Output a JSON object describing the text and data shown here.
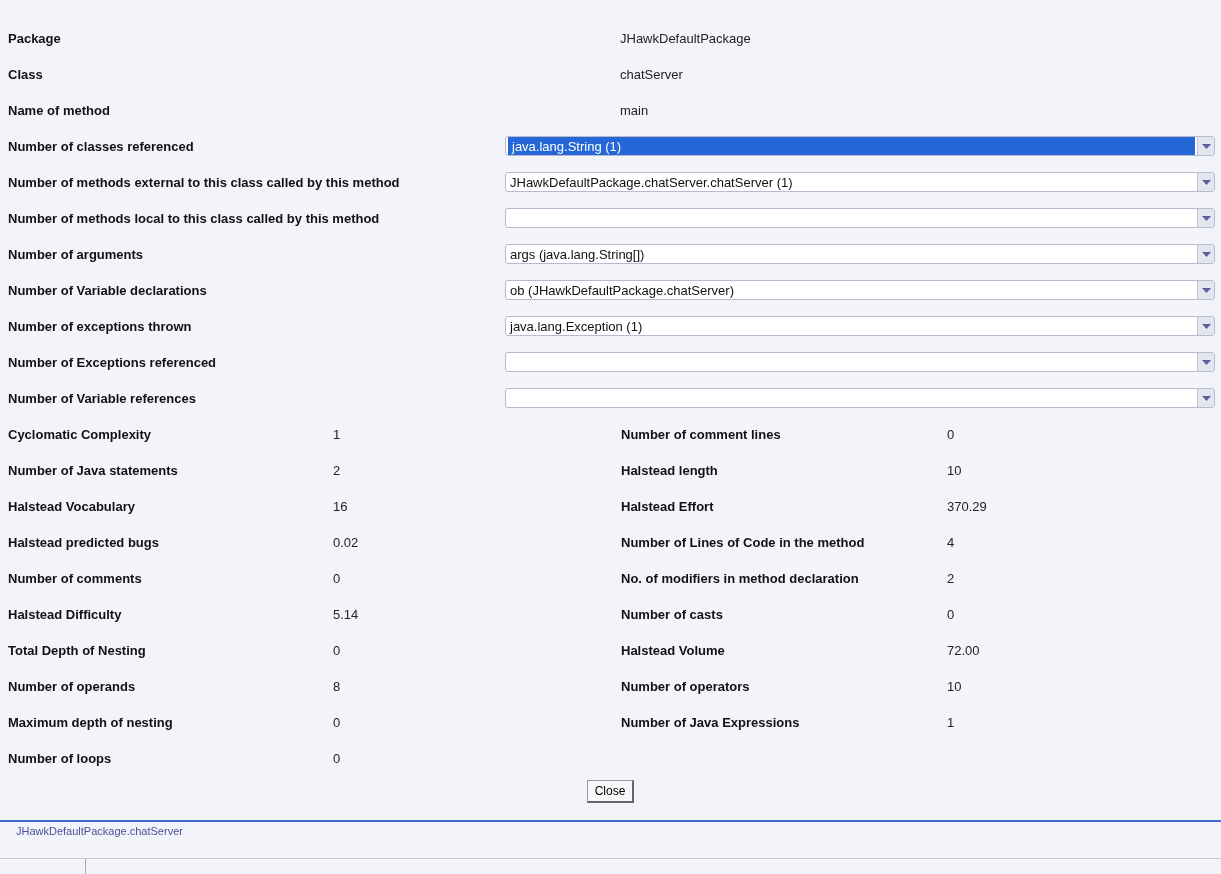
{
  "header": [
    {
      "label": "Package",
      "value": "JHawkDefaultPackage"
    },
    {
      "label": "Class",
      "value": "chatServer"
    },
    {
      "label": "Name of method",
      "value": "main"
    }
  ],
  "lists": [
    {
      "label": "Number of classes referenced",
      "value": "java.lang.String (1)",
      "selected": true
    },
    {
      "label": "Number of methods external to this class called by this method",
      "value": "JHawkDefaultPackage.chatServer.chatServer (1)",
      "selected": false
    },
    {
      "label": "Number of methods local to this class called by this method",
      "selected": false
    },
    {
      "label": "Number of arguments",
      "value": "args (java.lang.String[])",
      "selected": false
    },
    {
      "label": "Number of Variable declarations",
      "value": "ob (JHawkDefaultPackage.chatServer)",
      "selected": false
    },
    {
      "label": "Number of exceptions thrown",
      "value": "java.lang.Exception (1)",
      "selected": false
    },
    {
      "label": "Number of Exceptions referenced",
      "selected": false
    },
    {
      "label": "Number of Variable references",
      "selected": false
    }
  ],
  "metrics_left": [
    {
      "label": "Cyclomatic Complexity",
      "value": "1"
    },
    {
      "label": "Number of Java statements",
      "value": "2"
    },
    {
      "label": "Halstead Vocabulary",
      "value": "16"
    },
    {
      "label": "Halstead predicted bugs",
      "value": "0.02"
    },
    {
      "label": "Number of comments",
      "value": "0"
    },
    {
      "label": "Halstead Difficulty",
      "value": "5.14"
    },
    {
      "label": "Total Depth of Nesting",
      "value": "0"
    },
    {
      "label": "Number of operands",
      "value": "8"
    },
    {
      "label": "Maximum depth of nesting",
      "value": "0"
    },
    {
      "label": "Number of loops",
      "value": "0"
    }
  ],
  "metrics_right": [
    {
      "label": "Number of comment lines",
      "value": "0"
    },
    {
      "label": "Halstead length",
      "value": "10"
    },
    {
      "label": "Halstead Effort",
      "value": "370.29"
    },
    {
      "label": "Number of Lines of Code in the method",
      "value": "4"
    },
    {
      "label": "No. of modifiers in method declaration",
      "value": "2"
    },
    {
      "label": "Number of casts",
      "value": "0"
    },
    {
      "label": "Halstead Volume",
      "value": "72.00"
    },
    {
      "label": "Number of operators",
      "value": "10"
    },
    {
      "label": "Number of Java Expressions",
      "value": "1"
    }
  ],
  "close_button": "Close",
  "status_bar": {
    "text": "JHawkDefaultPackage.chatServer"
  }
}
